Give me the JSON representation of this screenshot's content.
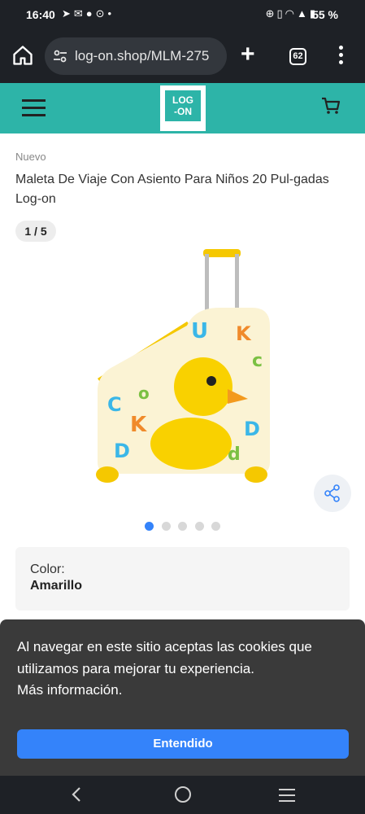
{
  "status_bar": {
    "time": "16:40",
    "battery": "55 %"
  },
  "browser": {
    "url": "log-on.shop/MLM-275",
    "tab_count": "62"
  },
  "site_header": {
    "logo_text_line1": "LOG",
    "logo_text_line2": "-ON",
    "accent_color": "#2db4a8"
  },
  "product": {
    "condition": "Nuevo",
    "title": "Maleta De Viaje Con Asiento Para Niños 20 Pul-gadas Log-on",
    "image_counter": "1 / 5",
    "image_index": 1,
    "image_total": 5,
    "color_label": "Color:",
    "color_value": "Amarillo"
  },
  "cookie_banner": {
    "line1": "Al navegar en este sitio aceptas las cookies que",
    "line2": "utilizamos para mejorar tu experiencia.",
    "line3": "Más información.",
    "button_label": "Entendido",
    "button_color": "#3483fa"
  },
  "icons": {
    "home": "home-icon",
    "site_settings": "tune-icon",
    "new_tab": "plus-icon",
    "tabs": "tabs-icon",
    "menu": "more-vert-icon",
    "hamburger": "hamburger-icon",
    "cart": "cart-icon",
    "share": "share-icon"
  }
}
